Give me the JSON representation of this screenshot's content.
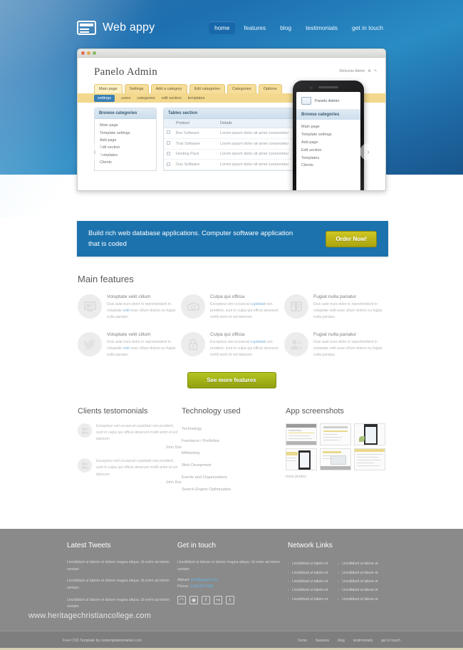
{
  "header": {
    "logo_text": "Web appy",
    "logo_icon": "browser-window-icon",
    "nav": [
      {
        "label": "home",
        "active": true
      },
      {
        "label": "features",
        "active": false
      },
      {
        "label": "blog",
        "active": false
      },
      {
        "label": "testimonials",
        "active": false
      },
      {
        "label": "get in touch",
        "active": false
      }
    ]
  },
  "browser_mockup": {
    "panel_title": "Panelo Admin",
    "user_label": "Welcome Admin",
    "tabs": [
      {
        "label": "Main page",
        "active": true
      },
      {
        "label": "Settings",
        "active": false
      },
      {
        "label": "Add a category",
        "active": false
      },
      {
        "label": "Edit categories",
        "active": false
      },
      {
        "label": "Categories",
        "active": false
      },
      {
        "label": "Options",
        "active": false
      }
    ],
    "subnav": [
      {
        "label": "settings",
        "selected": true
      },
      {
        "label": "users",
        "selected": false
      },
      {
        "label": "categories",
        "selected": false
      },
      {
        "label": "edit section",
        "selected": false
      },
      {
        "label": "templates",
        "selected": false
      }
    ],
    "browse_card": {
      "title": "Browse categories",
      "items": [
        "Main page",
        "Template settings",
        "Add page",
        "Edit section",
        "Templates",
        "Clients"
      ]
    },
    "tables_card": {
      "title": "Tables section",
      "columns": [
        "",
        "Product",
        "Details"
      ],
      "rows": [
        {
          "product": "Box Software",
          "details": "Lorem ipsum dolor sit amet consectetur"
        },
        {
          "product": "Trial Software",
          "details": "Lorem ipsum dolor sit amet consectetur"
        },
        {
          "product": "Hosting Pack",
          "details": "Lorem ipsum dolor sit amet consectetur"
        },
        {
          "product": "Duo Software",
          "details": "Lorem ipsum dolor sit amet consectetur"
        }
      ]
    },
    "phone": {
      "brand": "Panelo Admin",
      "section_title": "Browse categories",
      "items": [
        "Main page",
        "Template settings",
        "Add page",
        "Edit section",
        "Templates",
        "Clients"
      ]
    }
  },
  "cta": {
    "text": "Build rich web database applications. Computer software application that is coded",
    "button": "Order Now!"
  },
  "features": {
    "heading": "Main features",
    "items": [
      {
        "icon": "monitor-icon",
        "title": "Voluptate velit cillum",
        "text_before": "Duis aute irure dolor in reprehenderit in voluptate ",
        "link": "velit",
        "text_after": " esse cillum dolore eu fugiat nulla pariatur."
      },
      {
        "icon": "camera-icon",
        "title": "Culpa qui officia",
        "text_before": "Excepteur sint occaecat ",
        "link": "cupidatat",
        "text_after": " non proident, sunt in culpa qui officia deserunt mollit anim id est laborum."
      },
      {
        "icon": "documents-icon",
        "title": "Fugiat nulla pariatur",
        "text_before": "Duis aute irure dolor in reprehenderit in voluptate velit esse cillum dolore eu fugiat nulla pariatur.",
        "link": "",
        "text_after": ""
      },
      {
        "icon": "twitter-bird-icon",
        "title": "Voluptate velit cillum",
        "text_before": "Duis aute irure dolor in reprehenderit in voluptate ",
        "link": "velit",
        "text_after": " esse cillum dolore eu fugiat nulla pariatur."
      },
      {
        "icon": "lock-icon",
        "title": "Culpa qui officia",
        "text_before": "Excepteur sint occaecat ",
        "link": "cupidatat",
        "text_after": " non proident, sunt in culpa qui officia deserunt mollit anim id est laborum."
      },
      {
        "icon": "users-icon",
        "title": "Fugiat nulla pariatur",
        "text_before": "Duis aute irure dolor in reprehenderit in voluptate velit esse cillum dolore eu fugiat nulla pariatur.",
        "link": "",
        "text_after": ""
      }
    ],
    "more_button": "See more features"
  },
  "testimonials": {
    "heading": "Clients testomonials",
    "items": [
      {
        "quote": "Excepteur sint occaecat cupidatat non proident, sunt in culpa qui officia deserunt mollit anim id est laborum.",
        "author": "John Doe"
      },
      {
        "quote": "Excepteur sint occaecat cupidatat non proident, sunt in culpa qui officia deserunt mollit anim id est laborum.",
        "author": "John Doe"
      }
    ]
  },
  "technology": {
    "heading": "Technology used",
    "items": [
      "Technology",
      "Freelance / Portfolios",
      "MArketing",
      "Web Devepment",
      "Events and Organizations",
      "Search Engine Optimization"
    ]
  },
  "screenshots": {
    "heading": "App screenshots",
    "more_link": "more photos",
    "count": 6
  },
  "footer": {
    "tweets": {
      "heading": "Latest Tweets",
      "items": [
        "Lincididunt ut labore et dolore magna aliqua. Ut enim ad minim veniam",
        "Lincididunt ut labore et dolore magna aliqua. Ut enim ad minim veniam",
        "Lincididunt ut labore et dolore magna aliqua. Ut enim ad minim veniam"
      ]
    },
    "contact": {
      "heading": "Get in touch",
      "text": "Lincididunt ut labore et dolore magna aliqua. Ut enim ad minim veniam",
      "email_label": "Admail:",
      "email": "info@gmail.com",
      "phone_label": "Phone:",
      "phone": "1234-567-890",
      "social": [
        {
          "name": "rss-icon",
          "glyph": "◠"
        },
        {
          "name": "flickr-icon",
          "glyph": "◉"
        },
        {
          "name": "facebook-icon",
          "glyph": "f"
        },
        {
          "name": "share-icon",
          "glyph": "↪"
        },
        {
          "name": "tumblr-icon",
          "glyph": "t"
        }
      ]
    },
    "links": {
      "heading": "Network Links",
      "col1": [
        "Lincididunt ut labore et",
        "Lincididunt ut labore et",
        "Lincididunt ut labore et",
        "Lincididunt ut labore et",
        "Lincididunt ut labore et"
      ],
      "col2": [
        "Lincididunt ut labore et",
        "Lincididunt ut labore et",
        "Lincididunt ut labore et",
        "Lincididunt ut labore et",
        "Lincididunt ut labore et"
      ]
    }
  },
  "watermark": "www.heritagechristiancollege.com",
  "bottombar": {
    "credit": "Free CSS Template by csstemplatesmarket.com",
    "nav": [
      "home",
      "features",
      "blog",
      "testimonials",
      "get in touch"
    ]
  },
  "colors": {
    "hero_blue": "#2a8cc4",
    "cta_blue": "#1b72ad",
    "cta_button": "#c4bc1e",
    "more_button": "#a2b316",
    "footer_gray": "#8a8a8a",
    "panel_yellow": "#f3d98e",
    "link_blue": "#63b9e8"
  }
}
